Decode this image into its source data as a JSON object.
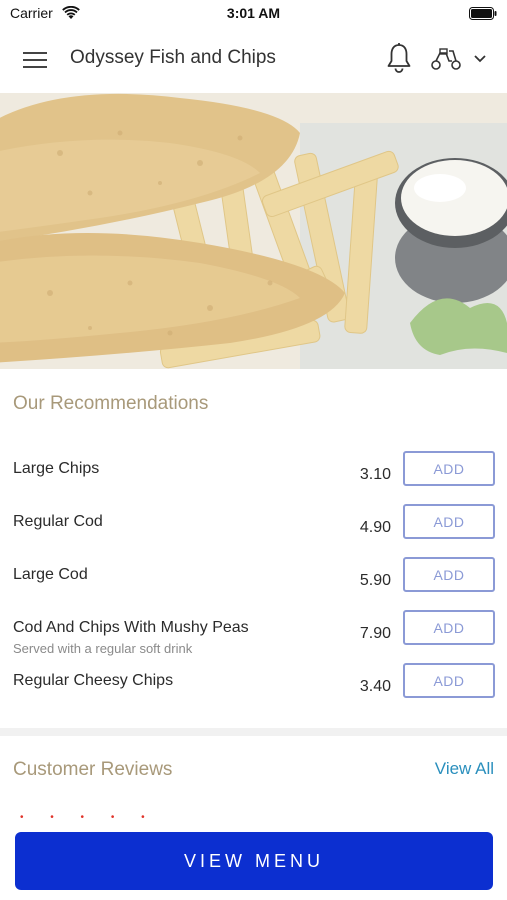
{
  "status_bar": {
    "carrier": "Carrier",
    "time": "3:01 AM"
  },
  "header": {
    "title": "Odyssey Fish and Chips",
    "icons": [
      "menu-icon",
      "bell-icon",
      "scooter-icon",
      "chevron-down-icon"
    ]
  },
  "hero": {
    "image": "fish-and-chips-photo"
  },
  "recommendations": {
    "title": "Our Recommendations",
    "items": [
      {
        "name": "Large Chips",
        "desc": "",
        "price": "3.10",
        "add_label": "ADD"
      },
      {
        "name": "Regular Cod",
        "desc": "",
        "price": "4.90",
        "add_label": "ADD"
      },
      {
        "name": "Large Cod",
        "desc": "",
        "price": "5.90",
        "add_label": "ADD"
      },
      {
        "name": "Cod And Chips With Mushy Peas",
        "desc": "Served with a regular soft drink",
        "price": "7.90",
        "add_label": "ADD"
      },
      {
        "name": "Regular Cheesy Chips",
        "desc": "",
        "price": "3.40",
        "add_label": "ADD"
      }
    ]
  },
  "reviews": {
    "title": "Customer Reviews",
    "view_all": "View All",
    "stars": "• • • • •"
  },
  "footer": {
    "view_menu": "VIEW MENU"
  },
  "colors": {
    "accent": "#0c2fd0",
    "section_title": "#a8997a",
    "link": "#2a8fbd",
    "add_border": "#8b9ad6"
  }
}
